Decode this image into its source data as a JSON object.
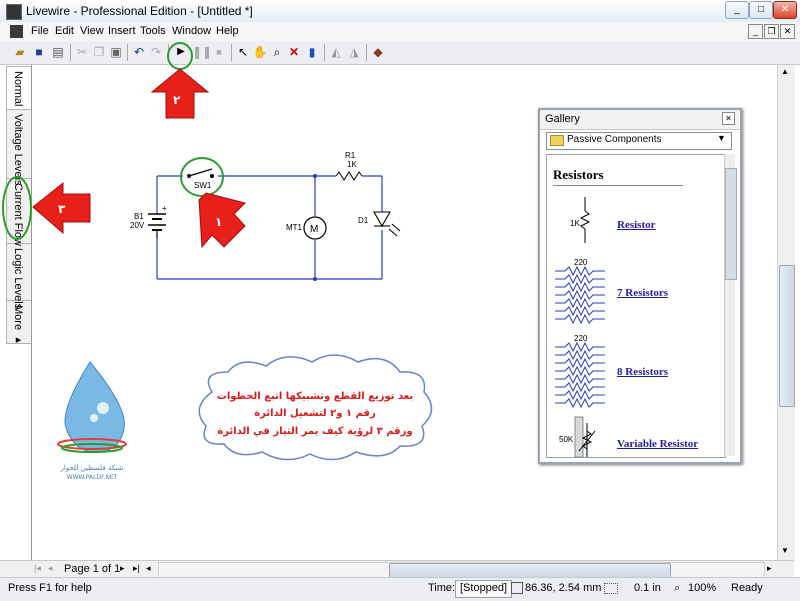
{
  "window": {
    "title": "Livewire - Professional Edition - [Untitled *]",
    "minimize": "_",
    "maximize": "□",
    "close": "✕"
  },
  "menu": [
    "File",
    "Edit",
    "View",
    "Insert",
    "Tools",
    "Window",
    "Help"
  ],
  "mdi_buttons": [
    "_",
    "❐",
    "✕"
  ],
  "left_tabs": [
    "Normal",
    "Voltage Levels",
    "Current Flow",
    "Logic Levels",
    "More ▸"
  ],
  "circuit": {
    "switch_label": "SW1",
    "resistor_label": "R1",
    "resistor_value": "1K",
    "battery_label": "B1",
    "battery_value": "20V",
    "plus": "+",
    "meter_label": "MT1",
    "meter_symbol": "M",
    "diode_label": "D1"
  },
  "annotations": {
    "arrow_top_number": "٢",
    "arrow_left_number": "٣",
    "arrow_switch_number": "١",
    "cloud_lines": [
      "بعد توزيع القطع وتشبيكها اتبع الخطوات",
      "رقم ١ و٢ لتشغيل الدائرة",
      "ورقم ٣ لرؤية كيف يمر التيار في الدائرة"
    ],
    "logo_text": "شبكة فلسطين للحوار",
    "logo_url": "WWW.PALDF.NET"
  },
  "gallery": {
    "title": "Gallery",
    "close": "✕",
    "category": "Passive Components",
    "heading": "Resistors",
    "items": [
      {
        "value": "1K",
        "link": "Resistor"
      },
      {
        "value": "220",
        "link": "7 Resistors"
      },
      {
        "value": "220",
        "link": "8 Resistors"
      },
      {
        "value": "50K",
        "link": "Variable Resistor"
      }
    ]
  },
  "page_nav": {
    "text": "Page 1 of 1"
  },
  "status": {
    "help": "Press F1 for help",
    "time_label": "Time:",
    "time_value": "[Stopped]",
    "coords": "86.36, 2.54 mm",
    "grid": "0.1 in",
    "zoom": "100%",
    "state": "Ready"
  },
  "colors": {
    "arrow_red": "#e8201a",
    "highlight_green": "#2e9b2e",
    "wire_blue": "#2a3cb8",
    "link": "#1f1f9f"
  }
}
